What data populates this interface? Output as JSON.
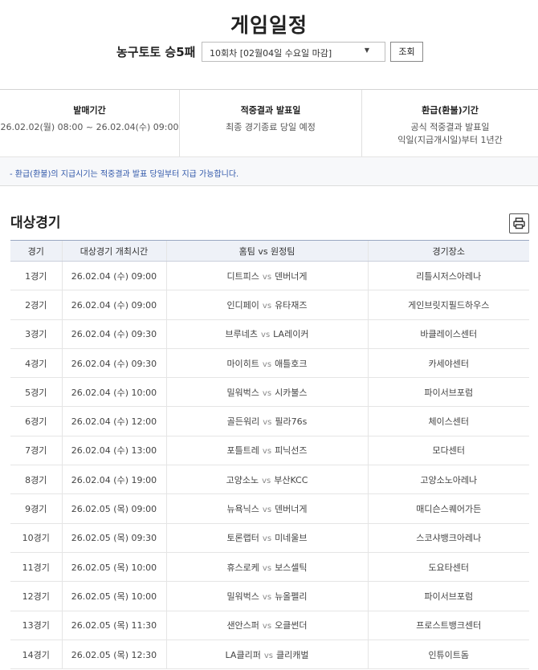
{
  "page_title": "게임일정",
  "game_name": "농구토토 승5패",
  "round_select": {
    "selected": "10회차 [02월04일 수요일 마감]"
  },
  "search_button": "조회",
  "info": [
    {
      "head": "발매기간",
      "lines": [
        "26.02.02(월) 08:00 ~ 26.02.04(수) 09:00"
      ]
    },
    {
      "head": "적중결과 발표일",
      "lines": [
        "최종 경기종료 당일 예정"
      ]
    },
    {
      "head": "환급(환불)기간",
      "lines": [
        "공식 적중결과 발표일",
        "익일(지급개시일)부터 1년간"
      ]
    }
  ],
  "notice": "- 환급(환불)의 지급시기는 적중결과 발표 당일부터 지급 가능합니다.",
  "section_title": "대상경기",
  "print_icon": "printer-icon",
  "table": {
    "headers": [
      "경기",
      "대상경기 개최시간",
      "홈팀 vs 원정팀",
      "경기장소"
    ],
    "vs_label": "vs",
    "rows": [
      {
        "no": "1경기",
        "time": "26.02.04 (수) 09:00",
        "home": "디트피스",
        "away": "덴버너게",
        "venue": "리틀시저스아레나"
      },
      {
        "no": "2경기",
        "time": "26.02.04 (수) 09:00",
        "home": "인디페이",
        "away": "유타재즈",
        "venue": "게인브릿지필드하우스"
      },
      {
        "no": "3경기",
        "time": "26.02.04 (수) 09:30",
        "home": "브루네츠",
        "away": "LA레이커",
        "venue": "바클레이스센터"
      },
      {
        "no": "4경기",
        "time": "26.02.04 (수) 09:30",
        "home": "마이히트",
        "away": "애틀호크",
        "venue": "카세야센터"
      },
      {
        "no": "5경기",
        "time": "26.02.04 (수) 10:00",
        "home": "밀워벅스",
        "away": "시카불스",
        "venue": "파이서브포럼"
      },
      {
        "no": "6경기",
        "time": "26.02.04 (수) 12:00",
        "home": "골든워리",
        "away": "필라76s",
        "venue": "체이스센터"
      },
      {
        "no": "7경기",
        "time": "26.02.04 (수) 13:00",
        "home": "포틀트레",
        "away": "피닉선즈",
        "venue": "모다센터"
      },
      {
        "no": "8경기",
        "time": "26.02.04 (수) 19:00",
        "home": "고양소노",
        "away": "부산KCC",
        "venue": "고양소노아레나"
      },
      {
        "no": "9경기",
        "time": "26.02.05 (목) 09:00",
        "home": "뉴욕닉스",
        "away": "덴버너게",
        "venue": "매디슨스퀘어가든"
      },
      {
        "no": "10경기",
        "time": "26.02.05 (목) 09:30",
        "home": "토론랩터",
        "away": "미네울브",
        "venue": "스코샤뱅크아레나"
      },
      {
        "no": "11경기",
        "time": "26.02.05 (목) 10:00",
        "home": "휴스로케",
        "away": "보스셀틱",
        "venue": "도요타센터"
      },
      {
        "no": "12경기",
        "time": "26.02.05 (목) 10:00",
        "home": "밀워벅스",
        "away": "뉴올펠리",
        "venue": "파이서브포럼"
      },
      {
        "no": "13경기",
        "time": "26.02.05 (목) 11:30",
        "home": "샌안스퍼",
        "away": "오클썬더",
        "venue": "프로스트뱅크센터"
      },
      {
        "no": "14경기",
        "time": "26.02.05 (목) 12:30",
        "home": "LA클리퍼",
        "away": "클리캐벌",
        "venue": "인튜이트돔"
      }
    ]
  }
}
